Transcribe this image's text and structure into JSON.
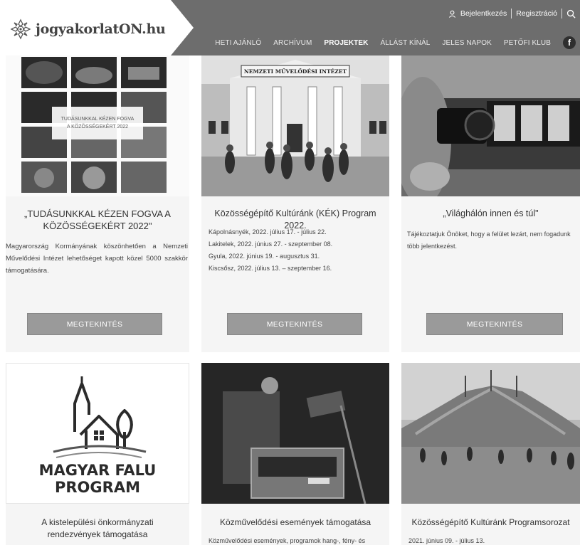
{
  "header": {
    "logo_text": "jogyakorlatON.hu",
    "login_label": "Bejelentkezés",
    "register_label": "Regisztráció",
    "nav": [
      "HETI AJÁNLÓ",
      "ARCHÍVUM",
      "PROJEKTEK",
      "ÁLLÁST KÍNÁL",
      "JELES NAPOK",
      "PETŐFI KLUB"
    ],
    "active_nav": "PROJEKTEK",
    "facebook_label": "f"
  },
  "cards": [
    {
      "title": "„TUDÁSUNKKAL KÉZEN FOGVA A KÖZÖSSÉGEKÉRT 2022\"",
      "image_caption_line1": "TUDÁSUNKKAL KÉZEN FOGVA",
      "image_caption_line2": "A KÖZÖSSÉGEKÉRT 2022",
      "text": "Magyarország Kormányának köszönhetően a Nemzeti Művelődési Intézet lehetőséget kapott közel 5000 szakkör támogatására.",
      "button": "MEGTEKINTÉS"
    },
    {
      "title": "Közösségépítő Kultúránk (KÉK) Program 2022.",
      "image_caption": "NEMZETI MŰVELŐDÉSI INTÉZET",
      "lines": [
        "Kápolnásnyék, 2022. július 17. - július 22.",
        "Lakitelek, 2022. június 27. - szeptember 08.",
        "Gyula, 2022. június 19. - augusztus 31.",
        "Kiscsősz, 2022. július 13. – szeptember 16."
      ],
      "button": "MEGTEKINTÉS"
    },
    {
      "title": "„Világhálón innen és túl\"",
      "lines": [
        "Tájékoztatjuk Önöket, hogy a felület lezárt, nem fogadunk",
        "több jelentkezést."
      ],
      "button": "MEGTEKINTÉS"
    },
    {
      "title": "A kistelepülési önkormányzati rendezvények támogatása",
      "image_line1": "MAGYAR FALU",
      "image_line2": "PROGRAM"
    },
    {
      "title": "Közművelődési események támogatása",
      "text": "Közművelődési események, programok hang-, fény- és"
    },
    {
      "title": "Közösségépítő Kultúránk Programsorozat",
      "text": "2021. június 09. - július 13."
    }
  ],
  "colors": {
    "header": "#6d6d6d",
    "button": "#9a9a9a",
    "card_bg": "#f5f5f5"
  }
}
